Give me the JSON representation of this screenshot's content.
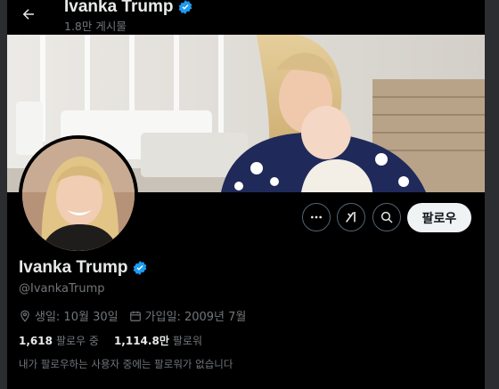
{
  "header": {
    "name": "Ivanka Trump",
    "post_count": "1.8만 게시물"
  },
  "profile": {
    "name": "Ivanka Trump",
    "handle": "@IvankaTrump",
    "birthday": "생일: 10월 30일",
    "joined": "가입일: 2009년 7월",
    "verified": true,
    "verified_color": "#1d9bf0"
  },
  "actions": {
    "more_icon": "more-dots-icon",
    "grok_icon": "grok-icon",
    "search_icon": "search-icon",
    "follow_label": "팔로우"
  },
  "stats": {
    "following_count": "1,618",
    "following_label": "팔로우 중",
    "followers_count": "1,114.8만",
    "followers_label": "팔로워"
  },
  "mutuals_text": "내가 팔로우하는 사용자 중에는 팔로워가 없습니다"
}
